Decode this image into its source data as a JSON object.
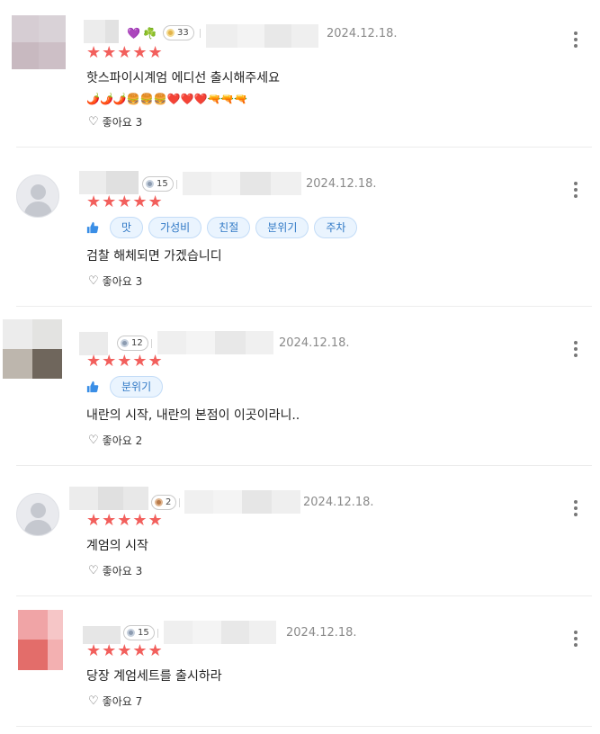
{
  "reviews": [
    {
      "date": "2024.12.18.",
      "badge_count": "33",
      "extra_badges": [
        "💜",
        "☘️"
      ],
      "stars": "★★★★★",
      "text": "핫스파이시계엄 에디선 출시해주세요",
      "emojis": "🌶️🌶️🌶️🍔🍔🍔❤️❤️❤️🔫🔫🔫",
      "like_label": "좋아요 3",
      "tags": []
    },
    {
      "date": "2024.12.18.",
      "badge_count": "15",
      "stars": "★★★★★",
      "text": "검찰 해체되면 가겠습니디",
      "like_label": "좋아요 3",
      "tags": [
        "맛",
        "가성비",
        "친절",
        "분위기",
        "주차"
      ]
    },
    {
      "date": "2024.12.18.",
      "badge_count": "12",
      "stars": "★★★★★",
      "text": "내란의 시작, 내란의 본점이 이곳이라니..",
      "like_label": "좋아요 2",
      "tags": [
        "분위기"
      ]
    },
    {
      "date": "2024.12.18.",
      "badge_count": "2",
      "stars": "★★★★★",
      "text": "계엄의 시작",
      "like_label": "좋아요 3",
      "tags": []
    },
    {
      "date": "2024.12.18.",
      "badge_count": "15",
      "stars": "★★★★★",
      "text": "당장 계엄세트를 출시하라",
      "like_label": "좋아요 7",
      "tags": []
    }
  ],
  "icons": {
    "heart": "♡",
    "more": "more-vertical-icon",
    "thumb": "thumbs-up-icon",
    "badge_level": "level-badge-icon"
  },
  "colors": {
    "star": "#f25f5c",
    "tag_text": "#2f78c5",
    "tag_bg": "#eaf4fe",
    "date": "#8a8a8a"
  }
}
